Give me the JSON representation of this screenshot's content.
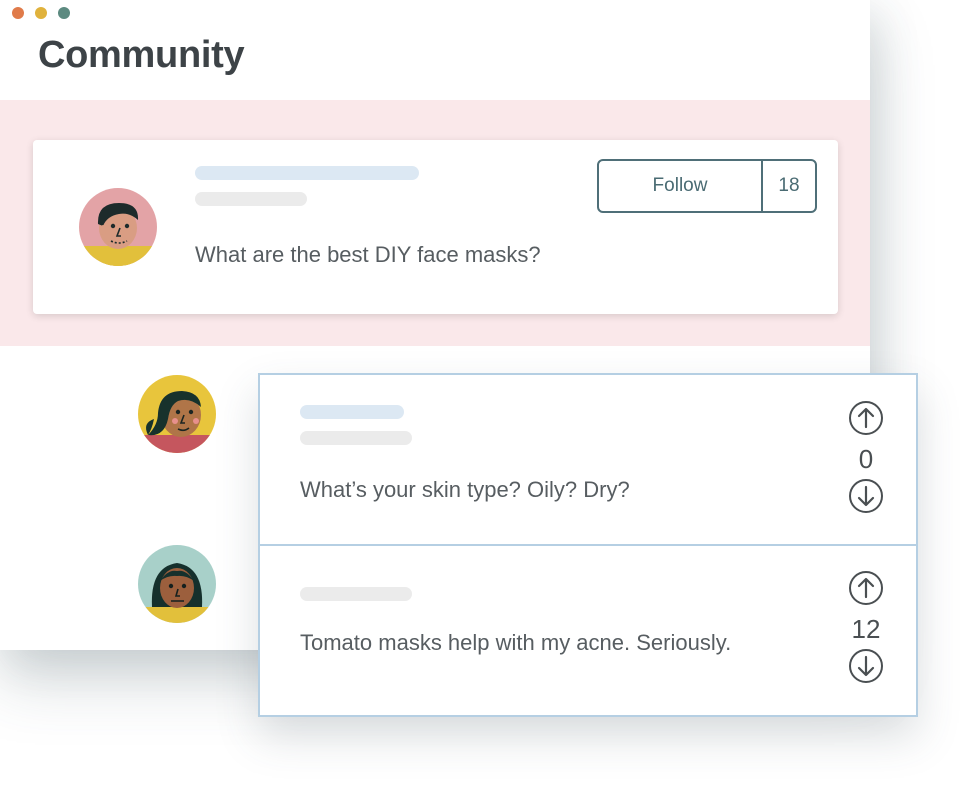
{
  "window": {
    "controls": [
      "close",
      "minimize",
      "maximize"
    ],
    "control_colors": [
      "#e07b4a",
      "#e0b23c",
      "#5c8a80"
    ],
    "title": "Community"
  },
  "post": {
    "question": "What are the best DIY face masks?",
    "follow_label": "Follow",
    "follow_count": "18"
  },
  "replies": [
    {
      "text": "What’s your skin type? Oily? Dry?",
      "votes": "0"
    },
    {
      "text": "Tomato masks help with my acne. Seriously.",
      "votes": "12"
    }
  ],
  "icons": {
    "upvote": "arrow-up-circle-icon",
    "downvote": "arrow-down-circle-icon"
  },
  "colors": {
    "band": "#fae8ea",
    "accent": "#4f6f78",
    "reply_border": "#b5cfe3"
  }
}
